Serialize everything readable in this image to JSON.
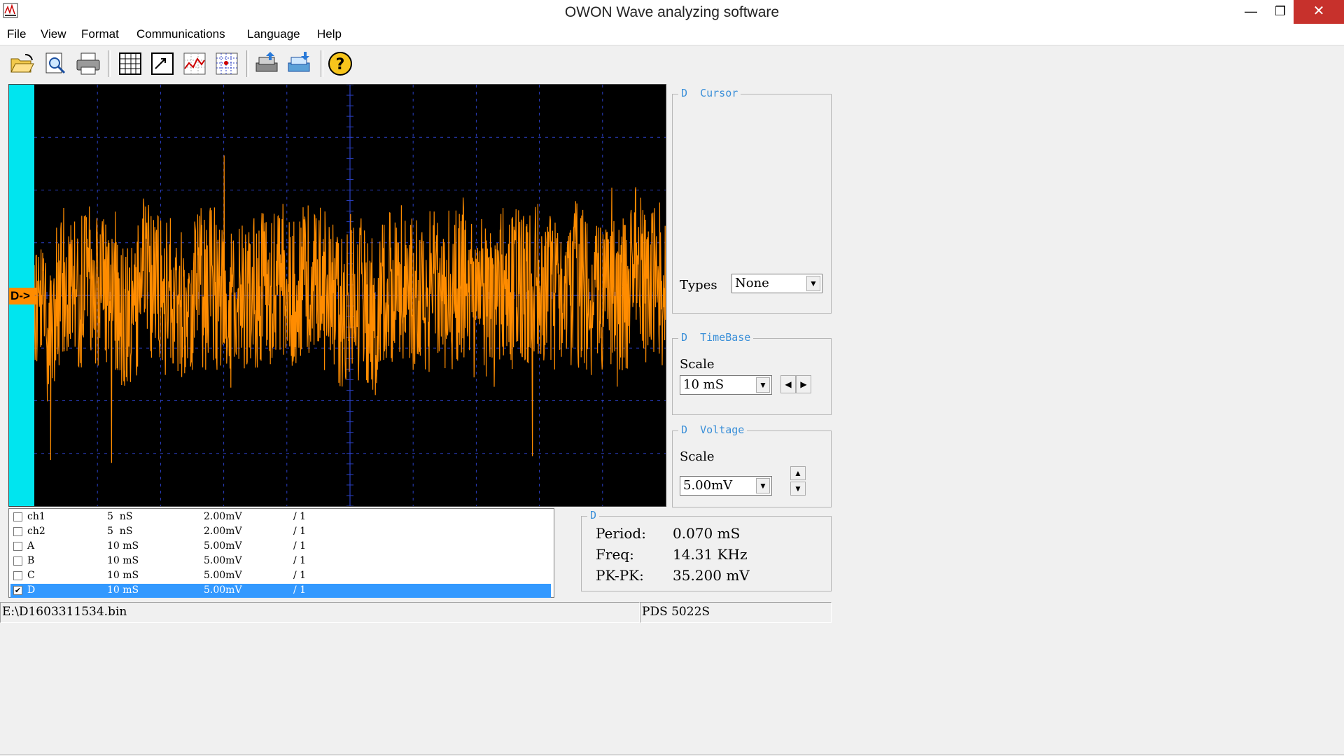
{
  "window": {
    "title": "OWON Wave analyzing software",
    "controls": {
      "minimize": "—",
      "maximize": "❐",
      "close": "✕"
    }
  },
  "menu": [
    "File",
    "View",
    "Format",
    "Communications",
    "Language",
    "Help"
  ],
  "toolbar": [
    "open-icon",
    "print-preview-icon",
    "print-icon",
    "table-icon",
    "export-icon",
    "waveform-icon",
    "grid-icon",
    "download-icon",
    "upload-icon",
    "help-icon"
  ],
  "scope": {
    "channel_marker": "D->",
    "colors": {
      "strip": "#00e5ef",
      "waveform": "#ff8c00",
      "grid": "#2a3fc4",
      "background": "#000000"
    }
  },
  "cursor_panel": {
    "channel": "D",
    "title": "Cursor",
    "types_label": "Types",
    "types_value": "None"
  },
  "timebase_panel": {
    "channel": "D",
    "title": "TimeBase",
    "scale_label": "Scale",
    "scale_value": "10 mS"
  },
  "voltage_panel": {
    "channel": "D",
    "title": "Voltage",
    "scale_label": "Scale",
    "scale_value": "5.00mV"
  },
  "channels": [
    {
      "name": "ch1",
      "time": "5  nS",
      "volt": "2.00mV",
      "probe": "/ 1",
      "checked": false,
      "selected": false
    },
    {
      "name": "ch2",
      "time": "5  nS",
      "volt": "2.00mV",
      "probe": "/ 1",
      "checked": false,
      "selected": false
    },
    {
      "name": "A",
      "time": "10 mS",
      "volt": "5.00mV",
      "probe": "/ 1",
      "checked": false,
      "selected": false
    },
    {
      "name": "B",
      "time": "10 mS",
      "volt": "5.00mV",
      "probe": "/ 1",
      "checked": false,
      "selected": false
    },
    {
      "name": "C",
      "time": "10 mS",
      "volt": "5.00mV",
      "probe": "/ 1",
      "checked": false,
      "selected": false
    },
    {
      "name": "D",
      "time": "10 mS",
      "volt": "5.00mV",
      "probe": "/ 1",
      "checked": true,
      "selected": true
    }
  ],
  "measurements": {
    "channel": "D",
    "period_label": "Period:",
    "period_value": "0.070 mS",
    "freq_label": "Freq:",
    "freq_value": "14.31 KHz",
    "pkpk_label": "PK-PK:",
    "pkpk_value": "35.200 mV"
  },
  "status": {
    "file_path": "E:\\D1603311534.bin",
    "device": "PDS 5022S"
  }
}
